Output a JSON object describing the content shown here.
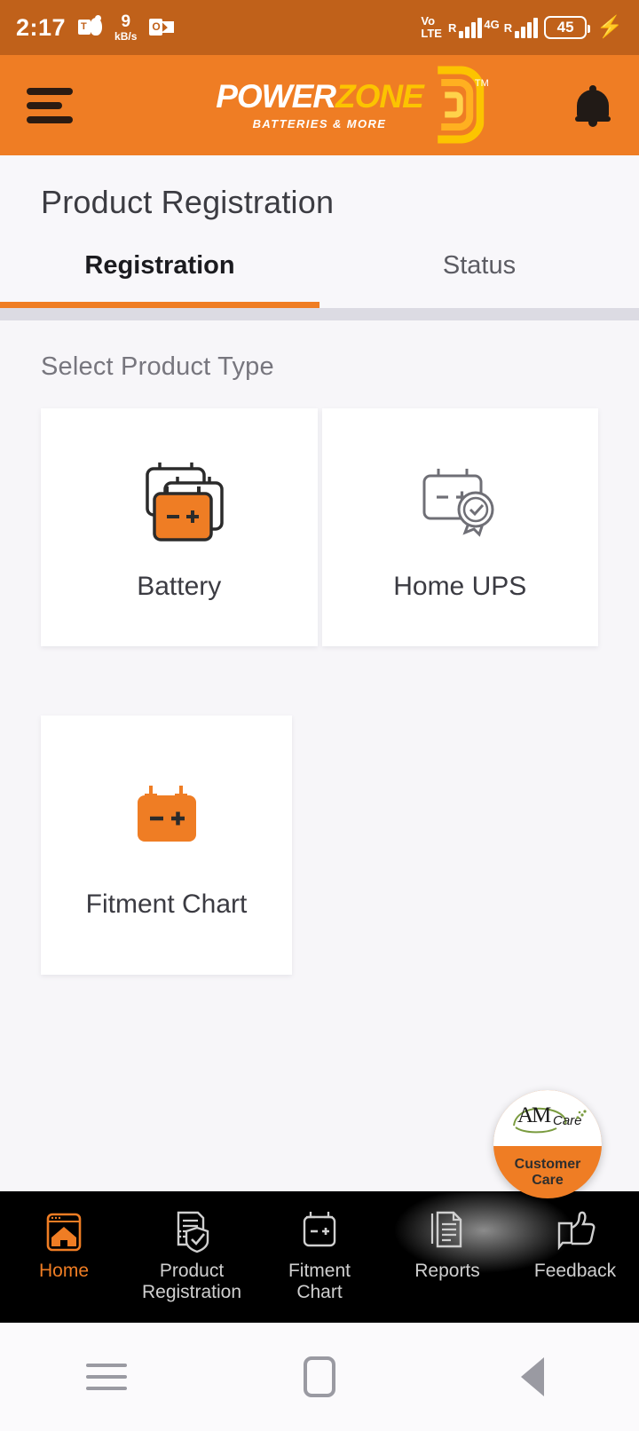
{
  "status_bar": {
    "time": "2:17",
    "teams_icon": "microsoft-teams-icon",
    "network_speed_value": "9",
    "network_speed_unit": "kB/s",
    "outlook_icon": "outlook-icon",
    "volte_line1": "Vo",
    "volte_line2": "LTE",
    "network_type": "4G",
    "sim1_roaming": "R",
    "sim2_roaming": "R",
    "battery_level": "45",
    "charging_icon": "bolt-icon"
  },
  "app_bar": {
    "menu_icon": "hamburger-menu-icon",
    "logo_part1": "POWER",
    "logo_part2": "ZONE",
    "logo_tagline": "BATTERIES & MORE",
    "logo_trademark": "TM",
    "notification_icon": "bell-icon"
  },
  "page": {
    "title": "Product Registration",
    "tabs": [
      {
        "label": "Registration",
        "active": true
      },
      {
        "label": "Status",
        "active": false
      }
    ],
    "section_label": "Select Product Type",
    "product_types": [
      {
        "label": "Battery",
        "icon": "stacked-batteries-icon"
      },
      {
        "label": "Home UPS",
        "icon": "battery-award-icon"
      },
      {
        "label": "Fitment Chart",
        "icon": "orange-battery-icon"
      }
    ]
  },
  "fab": {
    "brand_am": "AM",
    "brand_care": "Care",
    "label_line1": "Customer",
    "label_line2": "Care"
  },
  "bottom_nav": [
    {
      "label_line1": "Home",
      "label_line2": "",
      "icon": "home-window-icon",
      "active": true
    },
    {
      "label_line1": "Product",
      "label_line2": "Registration",
      "icon": "document-shield-icon",
      "active": false
    },
    {
      "label_line1": "Fitment",
      "label_line2": "Chart",
      "icon": "battery-outline-icon",
      "active": false
    },
    {
      "label_line1": "Reports",
      "label_line2": "",
      "icon": "documents-icon",
      "active": false
    },
    {
      "label_line1": "Feedback",
      "label_line2": "",
      "icon": "thumbs-up-icon",
      "active": false
    }
  ],
  "system_nav": {
    "recents_icon": "recents-icon",
    "home_icon": "android-home-icon",
    "back_icon": "android-back-icon"
  },
  "colors": {
    "brand_orange": "#ef7d24",
    "status_bar_orange": "#c0611a",
    "logo_yellow": "#fcc400",
    "page_bg": "#f7f6f9",
    "nav_bg": "#000000"
  }
}
